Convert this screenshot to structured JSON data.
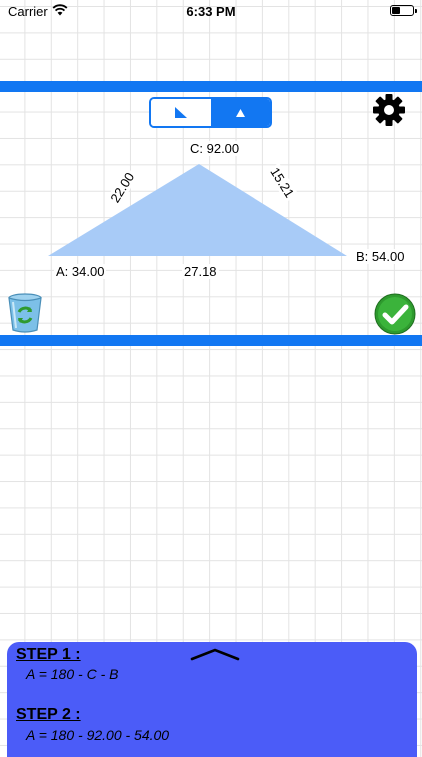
{
  "status_bar": {
    "carrier": "Carrier",
    "time": "6:33 PM"
  },
  "toolbar": {
    "segments": [
      {
        "name": "right-triangle",
        "icon": "right-triangle-icon",
        "selected": false
      },
      {
        "name": "triangle",
        "icon": "triangle-icon",
        "selected": true
      }
    ],
    "settings_icon": "gear-icon"
  },
  "triangle": {
    "angle_c": "C: 92.00",
    "angle_a": "A: 34.00",
    "angle_b": "B: 54.00",
    "side_ac": "22.00",
    "side_cb": "15.21",
    "side_ab": "27.18",
    "fill_color": "#a8cbf7"
  },
  "actions": {
    "clear_icon": "recycle-trash-icon",
    "confirm_icon": "checkmark-icon"
  },
  "steps": {
    "expand_icon": "chevron-up-icon",
    "items": [
      {
        "title": "STEP 1 :",
        "formula": "A = 180 - C - B"
      },
      {
        "title": "STEP 2 :",
        "formula": "A = 180 - 92.00 - 54.00"
      }
    ]
  },
  "colors": {
    "accent": "#1277f2",
    "panel": "#4b5cf8",
    "confirm": "#2e9a2e"
  }
}
